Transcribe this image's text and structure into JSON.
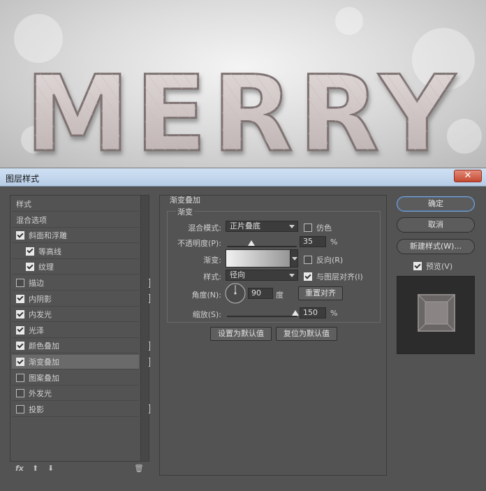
{
  "canvas": {
    "art_text": "MERRY"
  },
  "dialog": {
    "title": "图层样式",
    "close_symbol": "✕",
    "styles_list": [
      {
        "label": "样式",
        "checkbox": false,
        "checked": false,
        "indent": false,
        "plus": false,
        "selected": false
      },
      {
        "label": "混合选项",
        "checkbox": false,
        "checked": false,
        "indent": false,
        "plus": false,
        "selected": false
      },
      {
        "label": "斜面和浮雕",
        "checkbox": true,
        "checked": true,
        "indent": false,
        "plus": false,
        "selected": false
      },
      {
        "label": "等高线",
        "checkbox": true,
        "checked": true,
        "indent": true,
        "plus": false,
        "selected": false
      },
      {
        "label": "纹理",
        "checkbox": true,
        "checked": true,
        "indent": true,
        "plus": false,
        "selected": false
      },
      {
        "label": "描边",
        "checkbox": true,
        "checked": false,
        "indent": false,
        "plus": true,
        "selected": false
      },
      {
        "label": "内阴影",
        "checkbox": true,
        "checked": true,
        "indent": false,
        "plus": true,
        "selected": false
      },
      {
        "label": "内发光",
        "checkbox": true,
        "checked": true,
        "indent": false,
        "plus": false,
        "selected": false
      },
      {
        "label": "光泽",
        "checkbox": true,
        "checked": true,
        "indent": false,
        "plus": false,
        "selected": false
      },
      {
        "label": "颜色叠加",
        "checkbox": true,
        "checked": true,
        "indent": false,
        "plus": true,
        "selected": false
      },
      {
        "label": "渐变叠加",
        "checkbox": true,
        "checked": true,
        "indent": false,
        "plus": true,
        "selected": true
      },
      {
        "label": "图案叠加",
        "checkbox": true,
        "checked": false,
        "indent": false,
        "plus": false,
        "selected": false
      },
      {
        "label": "外发光",
        "checkbox": true,
        "checked": false,
        "indent": false,
        "plus": false,
        "selected": false
      },
      {
        "label": "投影",
        "checkbox": true,
        "checked": false,
        "indent": false,
        "plus": true,
        "selected": false
      }
    ],
    "footer": {
      "fx": "fx",
      "up": "⬆",
      "down": "⬇",
      "trash": "🗑"
    },
    "panel": {
      "section_title": "渐变叠加",
      "group_title": "渐变",
      "blend_mode_label": "混合模式:",
      "blend_mode_value": "正片叠底",
      "dither_label": "仿色",
      "dither_checked": false,
      "opacity_label": "不透明度(P):",
      "opacity_value": "35",
      "opacity_unit": "%",
      "opacity_level": 0.35,
      "gradient_label": "渐变:",
      "reverse_label": "反向(R)",
      "reverse_checked": false,
      "style_label": "样式:",
      "style_value": "径向",
      "align_label": "与图层对齐(I)",
      "align_checked": true,
      "angle_label": "角度(N):",
      "angle_value": "90",
      "angle_unit": "度",
      "reset_align_label": "重置对齐",
      "scale_label": "缩放(S):",
      "scale_value": "150",
      "scale_unit": "%",
      "scale_level": 0.98,
      "set_default_label": "设置为默认值",
      "reset_default_label": "复位为默认值"
    },
    "right": {
      "ok_label": "确定",
      "cancel_label": "取消",
      "new_style_label": "新建样式(W)...",
      "preview_label": "预览(V)",
      "preview_checked": true
    }
  }
}
